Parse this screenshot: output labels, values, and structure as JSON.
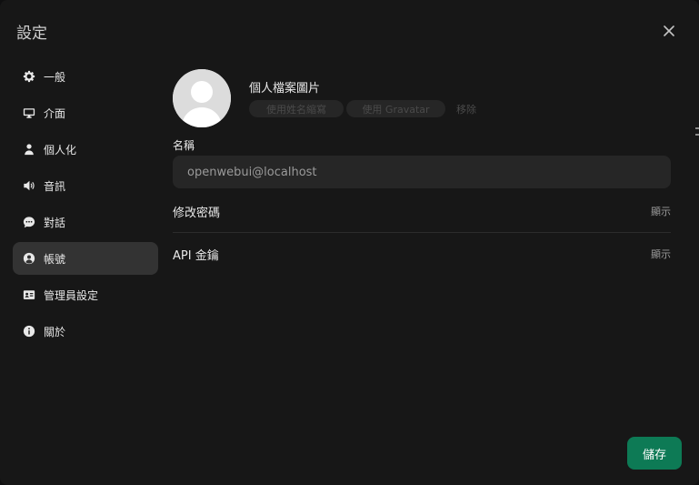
{
  "modal": {
    "title": "設定"
  },
  "sidebar": {
    "items": [
      {
        "label": "一般",
        "icon": "gear-icon"
      },
      {
        "label": "介面",
        "icon": "monitor-icon"
      },
      {
        "label": "個人化",
        "icon": "user-icon"
      },
      {
        "label": "音訊",
        "icon": "speaker-icon"
      },
      {
        "label": "對話",
        "icon": "chat-icon"
      },
      {
        "label": "帳號",
        "icon": "user-circle-icon",
        "active": true
      },
      {
        "label": "管理員設定",
        "icon": "id-card-icon"
      },
      {
        "label": "關於",
        "icon": "info-icon"
      }
    ]
  },
  "profile": {
    "label": "個人檔案圖片",
    "use_initials": "使用姓名縮寫",
    "use_gravatar": "使用 Gravatar",
    "remove": "移除"
  },
  "name": {
    "label": "名稱",
    "value": "openwebui@localhost"
  },
  "change_password": {
    "label": "修改密碼",
    "action": "顯示"
  },
  "api_keys": {
    "label": "API 金鑰",
    "action": "顯示"
  },
  "footer": {
    "save_label": "儲存"
  },
  "colors": {
    "accent": "#0d7a55",
    "background": "#171717",
    "active_item": "#333333"
  }
}
